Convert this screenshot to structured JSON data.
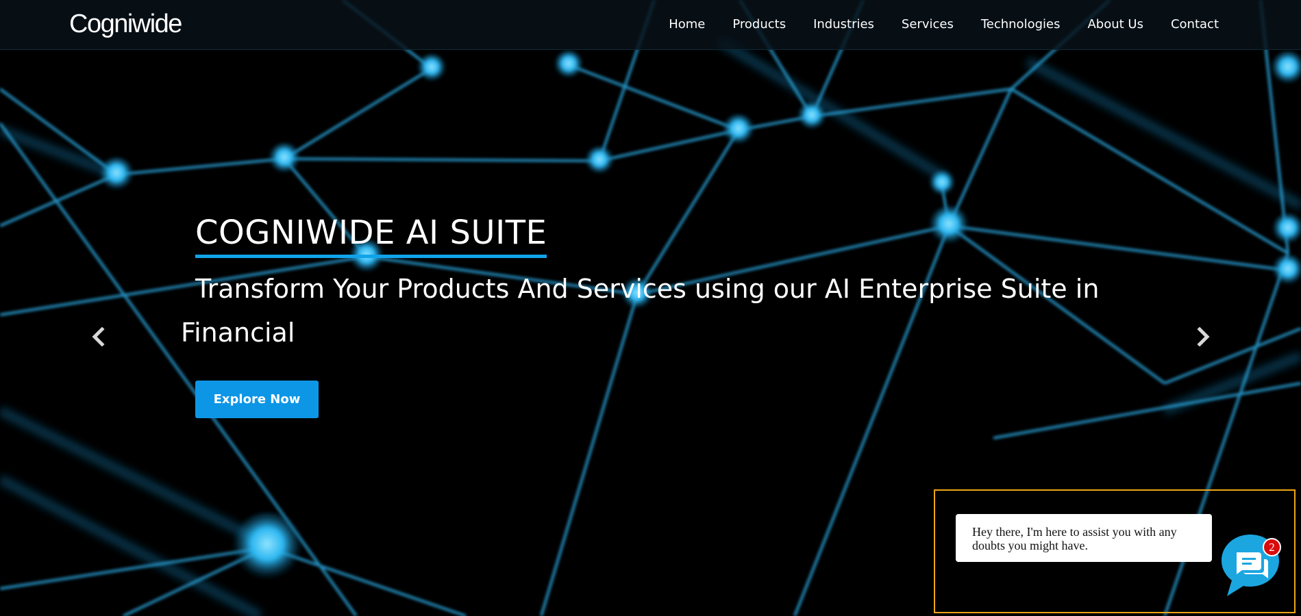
{
  "header": {
    "logo": "Cogniwide",
    "nav": [
      {
        "label": "Home",
        "name": "nav-home"
      },
      {
        "label": "Products",
        "name": "nav-products"
      },
      {
        "label": "Industries",
        "name": "nav-industries"
      },
      {
        "label": "Services",
        "name": "nav-services"
      },
      {
        "label": "Technologies",
        "name": "nav-technologies"
      },
      {
        "label": "About Us",
        "name": "nav-about-us"
      },
      {
        "label": "Contact",
        "name": "nav-contact"
      }
    ]
  },
  "hero": {
    "title": "COGNIWIDE AI SUITE",
    "subtitle": "Transform Your Products And Services using our AI Enterprise Suite in Financial",
    "cta_label": "Explore Now",
    "prev_icon": "chevron-left-icon",
    "next_icon": "chevron-right-icon"
  },
  "chat": {
    "message": "Hey there, I'm here to assist you with any doubts you might have.",
    "badge_count": "2",
    "launcher_icon": "chat-icon"
  },
  "colors": {
    "accent": "#0d96e6",
    "title_underline": "#11a3ea",
    "chat_blue": "#1ba6e0",
    "badge_red": "#d90b0b",
    "frame_orange": "#f0a616"
  }
}
